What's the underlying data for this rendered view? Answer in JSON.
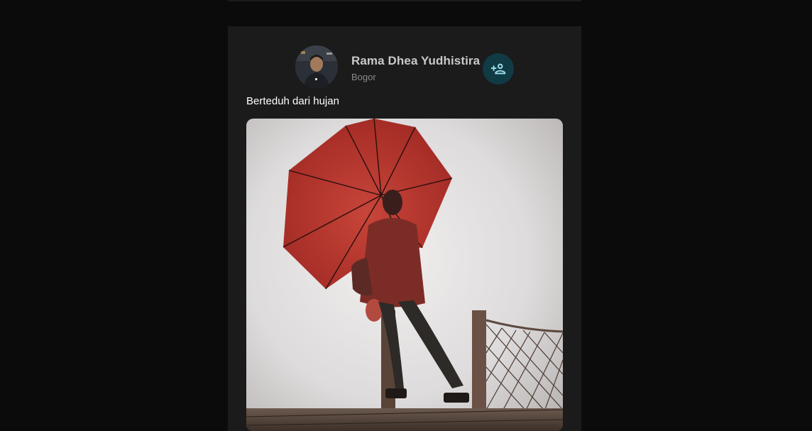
{
  "post": {
    "author": {
      "name": "Rama Dhea Yudhistira",
      "location": "Bogor"
    },
    "follow_icon": "person-add-icon",
    "caption": "Berteduh dari hujan",
    "image_subject": "person-with-red-umbrella-photo"
  },
  "colors": {
    "page_background": "#0b0b0b",
    "card_background": "#1b1b1b",
    "follow_button_bg": "#103a44",
    "follow_icon_color": "#9fe3ee",
    "name_color": "#c9c9c9",
    "location_color": "#8a8a8a"
  }
}
